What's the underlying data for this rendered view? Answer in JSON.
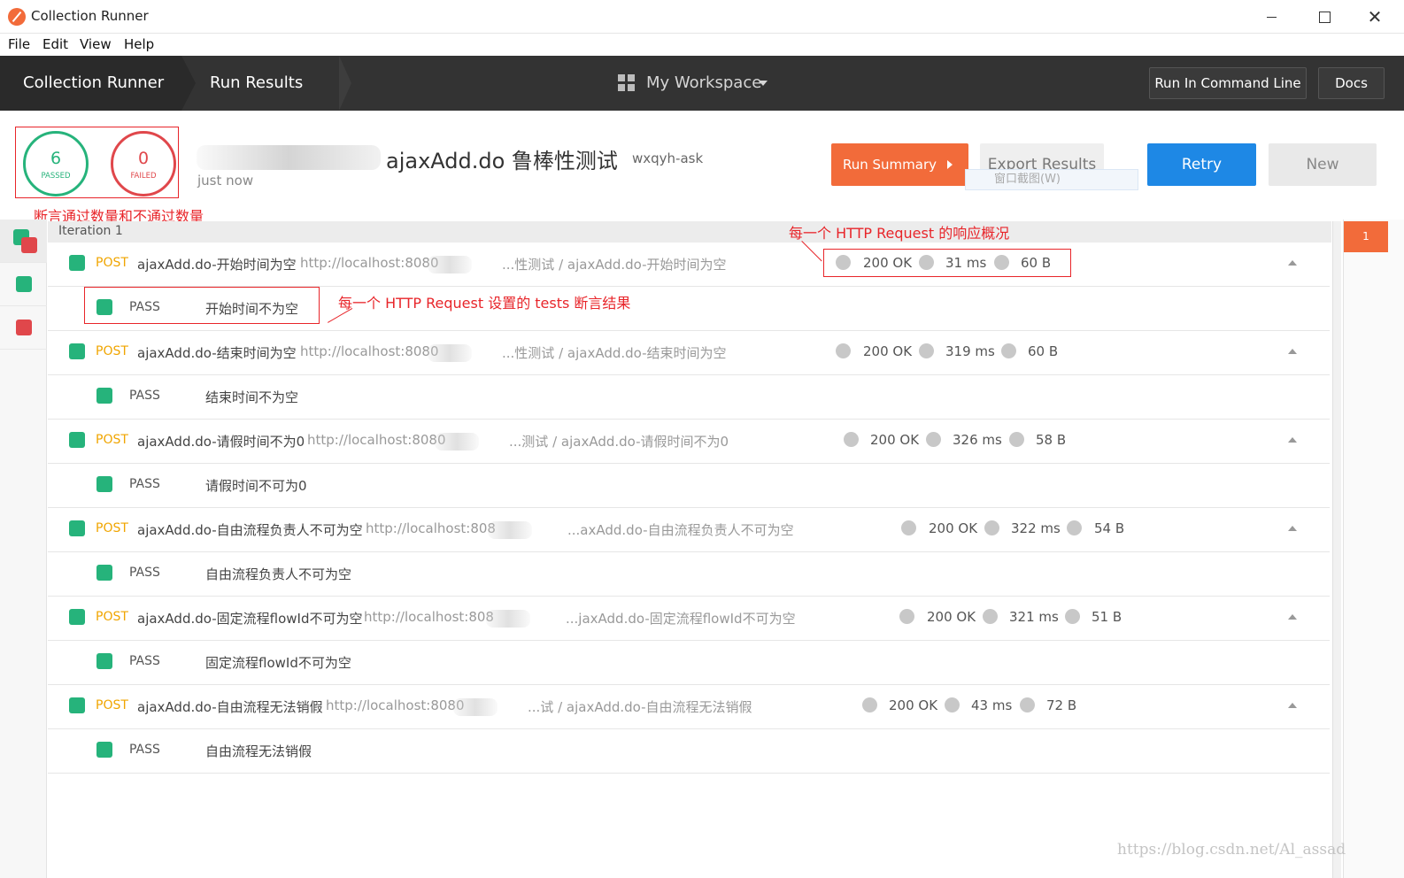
{
  "window": {
    "title": "Collection Runner"
  },
  "menu": [
    "File",
    "Edit",
    "View",
    "Help"
  ],
  "header": {
    "breadcrumb": [
      "Collection Runner",
      "Run Results"
    ],
    "workspace": "My Workspace",
    "cmd_button": "Run In Command Line",
    "docs_button": "Docs"
  },
  "summary": {
    "passed": {
      "count": "6",
      "label": "PASSED"
    },
    "failed": {
      "count": "0",
      "label": "FAILED"
    },
    "title": "ajaxAdd.do 鲁棒性测试",
    "environment": "wxqyh-ask",
    "time": "just now",
    "run_summary_button": "Run Summary",
    "export_button": "Export Results",
    "export_tooltip": "窗口截图(W)",
    "retry_button": "Retry",
    "new_button": "New"
  },
  "annotations": {
    "counts": "断言通过数量和不通过数量",
    "response": "每一个 HTTP Request 的响应概况",
    "tests": "每一个 HTTP Request 设置的 tests 断言结果"
  },
  "iteration": "Iteration 1",
  "requests": [
    {
      "method": "POST",
      "name": "ajaxAdd.do-开始时间为空",
      "url": "http://localhost:8080",
      "path": "...性测试 / ajaxAdd.do-开始时间为空",
      "status": "200 OK",
      "time": "31 ms",
      "size": "60 B",
      "test": {
        "result": "PASS",
        "name": "开始时间不为空"
      }
    },
    {
      "method": "POST",
      "name": "ajaxAdd.do-结束时间为空",
      "url": "http://localhost:8080",
      "path": "...性测试 / ajaxAdd.do-结束时间为空",
      "status": "200 OK",
      "time": "319 ms",
      "size": "60 B",
      "test": {
        "result": "PASS",
        "name": "结束时间不为空"
      }
    },
    {
      "method": "POST",
      "name": "ajaxAdd.do-请假时间不为0",
      "url": "http://localhost:8080",
      "path": "...测试 / ajaxAdd.do-请假时间不为0",
      "status": "200 OK",
      "time": "326 ms",
      "size": "58 B",
      "test": {
        "result": "PASS",
        "name": "请假时间不可为0"
      }
    },
    {
      "method": "POST",
      "name": "ajaxAdd.do-自由流程负责人不可为空",
      "url": "http://localhost:808",
      "path": "...axAdd.do-自由流程负责人不可为空",
      "status": "200 OK",
      "time": "322 ms",
      "size": "54 B",
      "test": {
        "result": "PASS",
        "name": "自由流程负责人不可为空"
      }
    },
    {
      "method": "POST",
      "name": "ajaxAdd.do-固定流程flowId不可为空",
      "url": "http://localhost:808",
      "path": "...jaxAdd.do-固定流程flowId不可为空",
      "status": "200 OK",
      "time": "321 ms",
      "size": "51 B",
      "test": {
        "result": "PASS",
        "name": "固定流程flowId不可为空"
      }
    },
    {
      "method": "POST",
      "name": "ajaxAdd.do-自由流程无法销假",
      "url": "http://localhost:8080",
      "path": "...试 / ajaxAdd.do-自由流程无法销假",
      "status": "200 OK",
      "time": "43 ms",
      "size": "72 B",
      "test": {
        "result": "PASS",
        "name": "自由流程无法销假"
      }
    }
  ],
  "right_badge": "1",
  "watermark": "https://blog.csdn.net/Al_assad",
  "colors": {
    "pass": "#26b37b",
    "fail": "#e0474b",
    "accent": "#f26b3a",
    "primary": "#1e88e5",
    "method": "#f0a500",
    "annotation": "#e8252a"
  }
}
